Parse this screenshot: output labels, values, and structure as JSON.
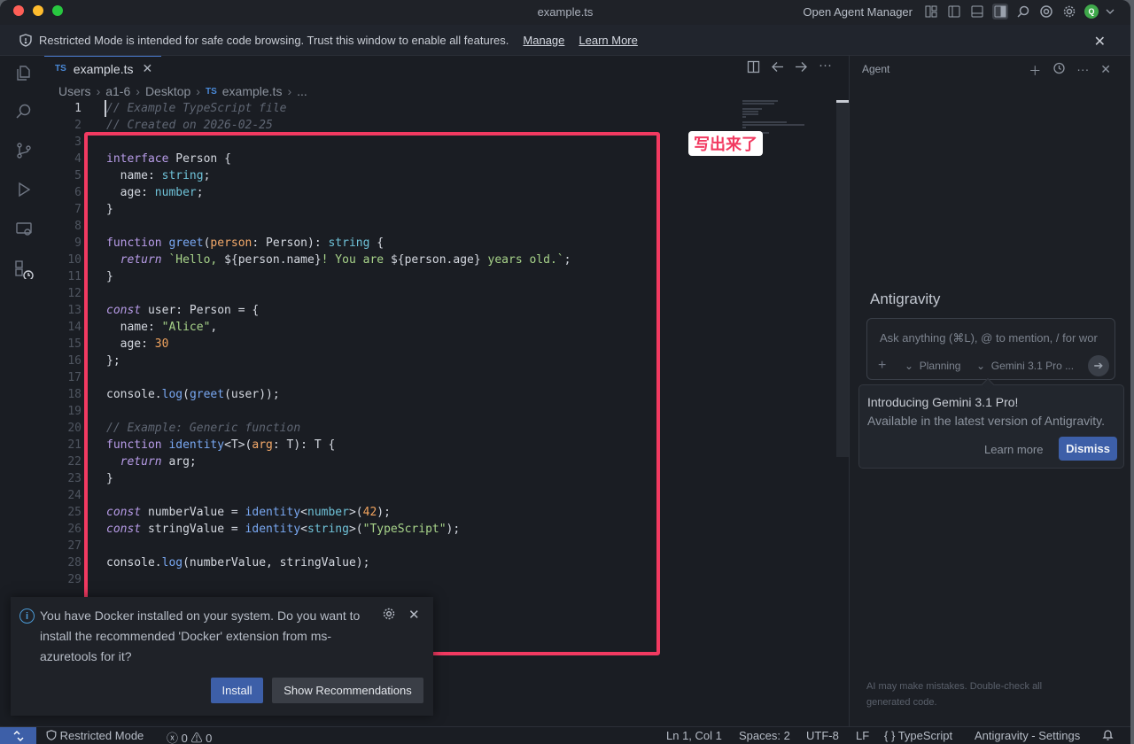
{
  "window": {
    "title": "example.ts"
  },
  "titlebar": {
    "agent_manager": "Open Agent Manager",
    "avatar_letter": "Q"
  },
  "banner": {
    "message": "Restricted Mode is intended for safe code browsing. Trust this window to enable all features.",
    "manage": "Manage",
    "learn_more": "Learn More"
  },
  "tab": {
    "lang": "TS",
    "name": "example.ts"
  },
  "breadcrumb": {
    "parts": [
      "Users",
      "a1-6",
      "Desktop"
    ],
    "lang": "TS",
    "file": "example.ts",
    "more": "..."
  },
  "code_lines": [
    {
      "n": "1",
      "html": "<span class=\"cm\">// Example TypeScript file</span>"
    },
    {
      "n": "2",
      "html": "<span class=\"cm\">// Created on 2026-02-25</span>"
    },
    {
      "n": "3",
      "html": ""
    },
    {
      "n": "4",
      "html": "<span class=\"kw\">interface</span> Person {"
    },
    {
      "n": "5",
      "html": "  name: <span class=\"ty\">string</span>;"
    },
    {
      "n": "6",
      "html": "  age: <span class=\"ty\">number</span>;"
    },
    {
      "n": "7",
      "html": "}"
    },
    {
      "n": "8",
      "html": ""
    },
    {
      "n": "9",
      "html": "<span class=\"kw\">function</span> <span class=\"fn\">greet</span>(<span class=\"pa\">person</span>: Person): <span class=\"ty\">string</span> {"
    },
    {
      "n": "10",
      "html": "  <span class=\"kwi\">return</span> <span class=\"st\">`Hello, </span>${person.name}<span class=\"st\">! You are </span>${person.age}<span class=\"st\"> years old.`</span>;"
    },
    {
      "n": "11",
      "html": "}"
    },
    {
      "n": "12",
      "html": ""
    },
    {
      "n": "13",
      "html": "<span class=\"kwi\">const</span> user: Person = {"
    },
    {
      "n": "14",
      "html": "  name: <span class=\"st\">\"Alice\"</span>,"
    },
    {
      "n": "15",
      "html": "  age: <span class=\"nu\">30</span>"
    },
    {
      "n": "16",
      "html": "};"
    },
    {
      "n": "17",
      "html": ""
    },
    {
      "n": "18",
      "html": "console.<span class=\"fn\">log</span>(<span class=\"fn\">greet</span>(user));"
    },
    {
      "n": "19",
      "html": ""
    },
    {
      "n": "20",
      "html": "<span class=\"cm\">// Example: Generic function</span>"
    },
    {
      "n": "21",
      "html": "<span class=\"kw\">function</span> <span class=\"fn\">identity</span>&lt;T&gt;(<span class=\"pa\">arg</span>: T): T {"
    },
    {
      "n": "22",
      "html": "  <span class=\"kwi\">return</span> arg;"
    },
    {
      "n": "23",
      "html": "}"
    },
    {
      "n": "24",
      "html": ""
    },
    {
      "n": "25",
      "html": "<span class=\"kwi\">const</span> numberValue = <span class=\"fn\">identity</span>&lt;<span class=\"ty\">number</span>&gt;(<span class=\"nu\">42</span>);"
    },
    {
      "n": "26",
      "html": "<span class=\"kwi\">const</span> stringValue = <span class=\"fn\">identity</span>&lt;<span class=\"ty\">string</span>&gt;(<span class=\"st\">\"TypeScript\"</span>);"
    },
    {
      "n": "27",
      "html": ""
    },
    {
      "n": "28",
      "html": "console.<span class=\"fn\">log</span>(numberValue, stringValue);"
    },
    {
      "n": "29",
      "html": ""
    }
  ],
  "annotation": {
    "label": "写出来了"
  },
  "notification": {
    "message": "You have Docker installed on your system. Do you want to install the recommended 'Docker' extension from ms-azuretools for it?",
    "install": "Install",
    "show_recommendations": "Show Recommendations"
  },
  "agent": {
    "title": "Agent",
    "name": "Antigravity",
    "placeholder": "Ask anything (⌘L), @ to mention, / for wor",
    "mode": "Planning",
    "model": "Gemini 3.1 Pro ...",
    "popover_title": "Introducing Gemini 3.1 Pro!",
    "popover_sub": "Available in the latest version of Antigravity.",
    "learn_more": "Learn more",
    "dismiss": "Dismiss",
    "footer": "AI may make mistakes. Double-check all generated code."
  },
  "statusbar": {
    "restricted": "Restricted Mode",
    "errors": "0",
    "warnings": "0",
    "position": "Ln 1, Col 1",
    "spaces": "Spaces: 2",
    "encoding": "UTF-8",
    "eol": "LF",
    "language": "TypeScript",
    "settings": "Antigravity - Settings"
  }
}
